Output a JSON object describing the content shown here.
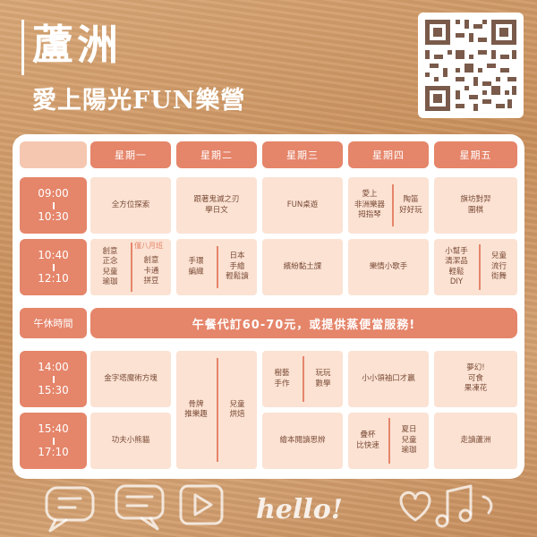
{
  "header": {
    "title": "蘆洲",
    "subtitle": "愛上陽光FUN樂營"
  },
  "qr": {
    "icon": "qr-code-icon"
  },
  "days": [
    "星期一",
    "星期二",
    "星期三",
    "星期四",
    "星期五"
  ],
  "times": {
    "slot1": {
      "start": "09:00",
      "end": "10:30"
    },
    "slot2": {
      "start": "10:40",
      "end": "12:10"
    },
    "slot3": {
      "start": "14:00",
      "end": "15:30"
    },
    "slot4": {
      "start": "15:40",
      "end": "17:10"
    }
  },
  "lunch": {
    "label": "午休時間",
    "note": "午餐代訂60-70元，或提供蒸便當服務!"
  },
  "slot1": {
    "mon": "全方位探索",
    "tue": "跟著鬼滅之刃\n學日文",
    "wed": "FUN桌遊",
    "thu_a": "愛上\n非洲樂器\n拇指琴",
    "thu_b": "陶笛\n好好玩",
    "fri": "旗坊對羿\n圍棋"
  },
  "slot2": {
    "mon_a": "創意\n正念\n兒童\n瑜珈",
    "mon_tag": "僅八月班",
    "mon_b": "創意\n卡通\n拼豆",
    "tue_a": "手環\n編織",
    "tue_b": "日本\n手繪\n輕鬆讀",
    "wed": "繽紛黏土課",
    "thu": "樂情小歌手",
    "fri_a": "小幫手\n清潔品\n輕鬆\nDIY",
    "fri_b": "兒童\n流行\n街舞"
  },
  "afternoon": {
    "mon_3": "金字塔魔術方塊",
    "mon_4": "功夫小熊貓",
    "tue_a": "骨牌\n推樂趣",
    "tue_b": "兒童\n烘焙",
    "wed_a": "樹藝\n手作",
    "wed_b": "玩玩\n數學",
    "wed_4": "繪本閱讀思辨",
    "thu_3": "小小領袖口才贏",
    "thu_4a": "疊杯\n比快速",
    "thu_4b": "夏日\n兒童\n瑜珈",
    "fri_3": "夢幻!\n可食\n果凍花",
    "fri_4": "走讀蘆洲"
  },
  "doodles": {
    "text": "hello!"
  },
  "colors": {
    "accent": "#e5856a",
    "cell": "#fbe2d3",
    "text": "#7a4a36",
    "sand": "#cf9a68"
  }
}
